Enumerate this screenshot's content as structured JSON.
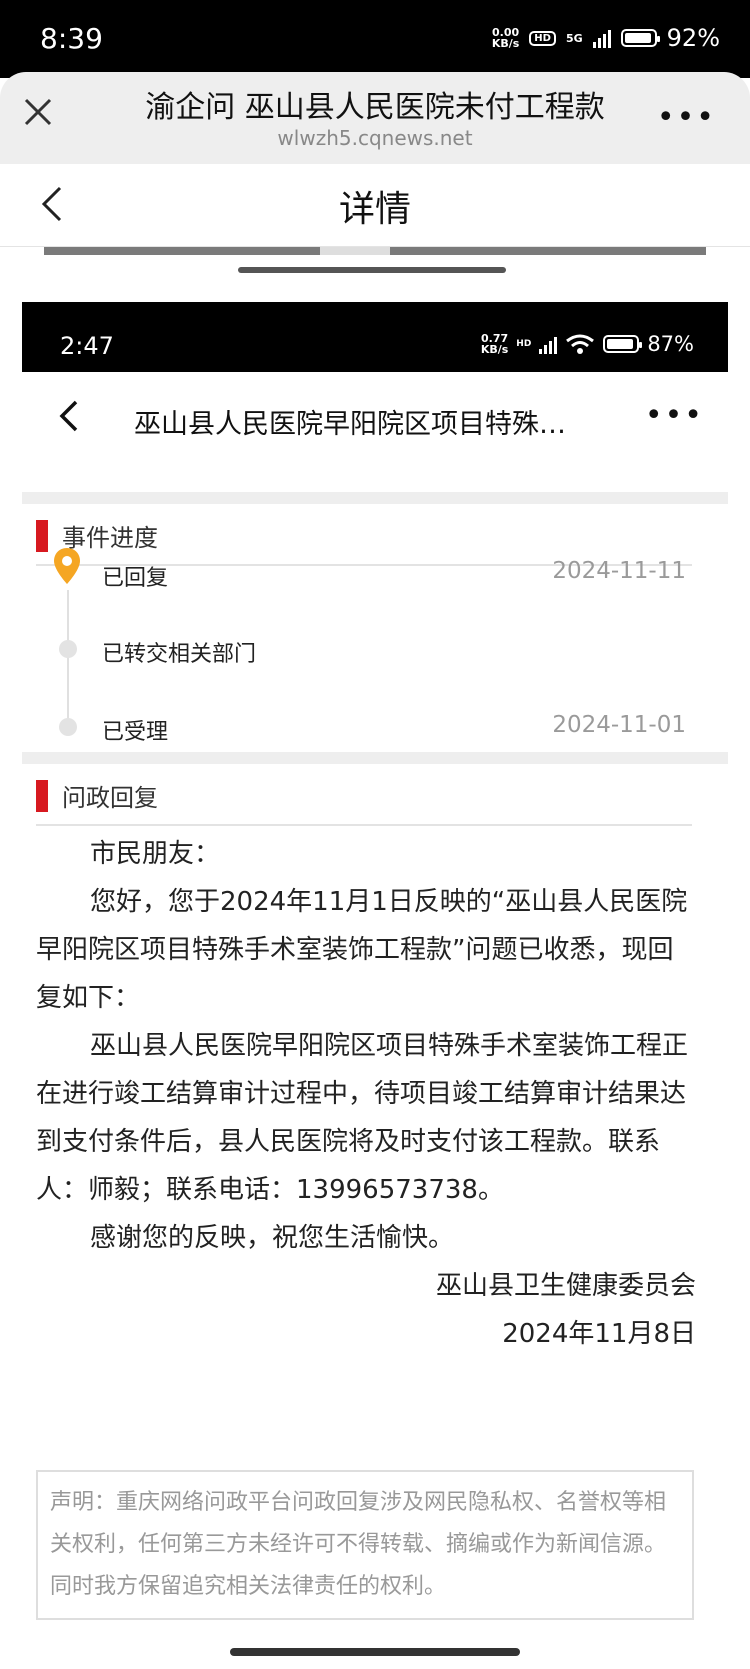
{
  "outer_status": {
    "time": "8:39",
    "net_speed_top": "0.00",
    "net_speed_unit": "KB/s",
    "hd": "HD",
    "net": "5G",
    "battery": "92%"
  },
  "browser": {
    "title": "渝企问 巫山县人民医院未付工程款",
    "url": "wlwzh5.cqnews.net",
    "more": "•••"
  },
  "page": {
    "title": "详情"
  },
  "inner_status": {
    "time": "2:47",
    "net_speed_top": "0.77",
    "net_speed_unit": "KB/s",
    "hd": "HD",
    "battery": "87%"
  },
  "inner_nav": {
    "title": "巫山县人民医院早阳院区项目特殊…",
    "more": "•••"
  },
  "progress": {
    "section_title": "事件进度",
    "items": [
      {
        "label": "已回复",
        "date": "2024-11-11"
      },
      {
        "label": "已转交相关部门",
        "date": ""
      },
      {
        "label": "已受理",
        "date": "2024-11-01"
      }
    ]
  },
  "reply": {
    "section_title": "问政回复",
    "greeting": "市民朋友：",
    "paragraph1": "您好，您于2024年11月1日反映的“巫山县人民医院早阳院区项目特殊手术室装饰工程款”问题已收悉，现回复如下：",
    "paragraph2": "巫山县人民医院早阳院区项目特殊手术室装饰工程正在进行竣工结算审计过程中，待项目竣工结算审计结果达到支付条件后，县人民医院将及时支付该工程款。联系人：师毅；联系电话：13996573738。",
    "paragraph3": "感谢您的反映，祝您生活愉快。",
    "signature": "巫山县卫生健康委员会",
    "date": "2024年11月8日"
  },
  "notice": {
    "text": "声明：重庆网络问政平台问政回复涉及网民隐私权、名誉权等相关权利，任何第三方未经许可不得转载、摘编或作为新闻信源。同时我方保留追究相关法律责任的权利。"
  },
  "colors": {
    "accent_red": "#d71920",
    "pin_yellow": "#f5a623"
  }
}
